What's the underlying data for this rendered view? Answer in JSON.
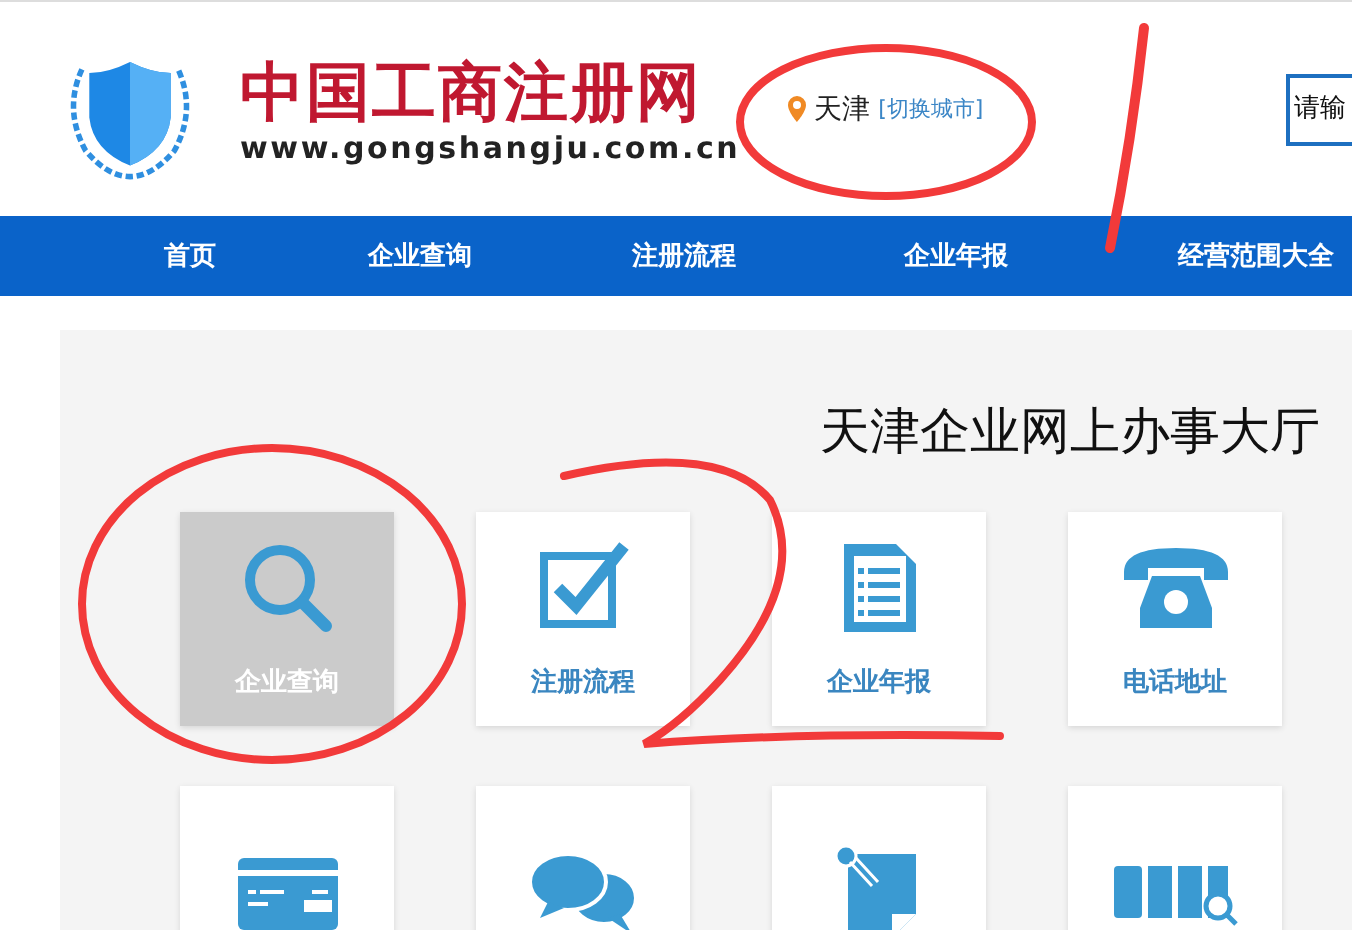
{
  "header": {
    "site_name": "中国工商注册网",
    "site_url": "www.gongshangju.com.cn",
    "location": {
      "city": "天津",
      "switch_link": "[切换城市]"
    },
    "search": {
      "placeholder": "请输"
    }
  },
  "nav": {
    "items": [
      {
        "label": "首页"
      },
      {
        "label": "企业查询"
      },
      {
        "label": "注册流程"
      },
      {
        "label": "企业年报"
      },
      {
        "label": "经营范围大全"
      }
    ]
  },
  "hall": {
    "title": "天津企业网上办事大厅",
    "tiles": [
      {
        "kind": "search",
        "label": "企业查询",
        "selected": true
      },
      {
        "kind": "checkbox",
        "label": "注册流程",
        "selected": false
      },
      {
        "kind": "document",
        "label": "企业年报",
        "selected": false
      },
      {
        "kind": "phone",
        "label": "电话地址",
        "selected": false
      },
      {
        "kind": "card",
        "selected": false
      },
      {
        "kind": "chat",
        "selected": false
      },
      {
        "kind": "note",
        "selected": false
      },
      {
        "kind": "archive",
        "selected": false
      }
    ]
  }
}
